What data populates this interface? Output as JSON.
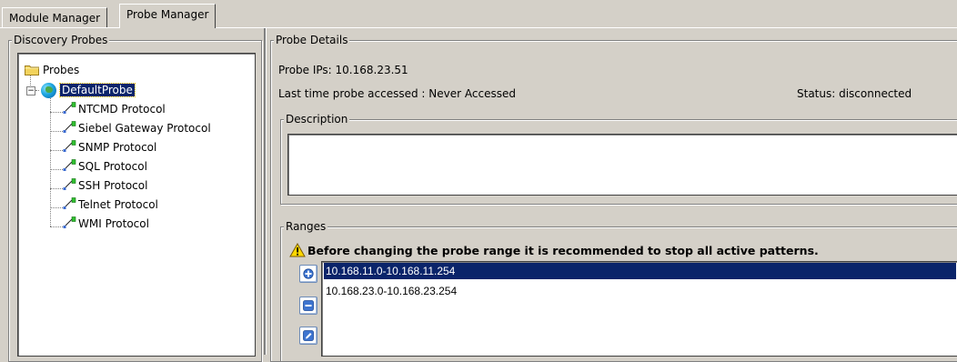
{
  "tabs": [
    {
      "label": "Module Manager",
      "active": false
    },
    {
      "label": "Probe Manager",
      "active": true
    }
  ],
  "discovery": {
    "title": "Discovery Probes",
    "tree": {
      "root_label": "Probes",
      "probe_label": "DefaultProbe",
      "protocols": [
        "NTCMD Protocol",
        "Siebel Gateway Protocol",
        "SNMP Protocol",
        "SQL Protocol",
        "SSH Protocol",
        "Telnet Protocol",
        "WMI Protocol"
      ]
    }
  },
  "details": {
    "title": "Probe Details",
    "probe_ips": "Probe IPs: 10.168.23.51",
    "last_accessed": "Last time probe accessed : Never Accessed",
    "status": "Status: disconnected",
    "description_title": "Description",
    "description_value": ""
  },
  "ranges": {
    "title": "Ranges",
    "warning": "Before changing the probe range it is recommended to stop all active patterns.",
    "items": [
      "10.168.11.0-10.168.11.254",
      "10.168.23.0-10.168.23.254"
    ],
    "selected_index": 0
  },
  "colors": {
    "window_bg": "#d4d0c8",
    "selection": "#0a246a",
    "selection_text": "#ffffff"
  },
  "icons": {
    "folder": "folder-icon",
    "globe": "globe-icon",
    "protocol": "protocol-icon",
    "warning": "warning-icon",
    "add": "add-icon",
    "remove": "remove-icon",
    "edit": "edit-icon"
  }
}
